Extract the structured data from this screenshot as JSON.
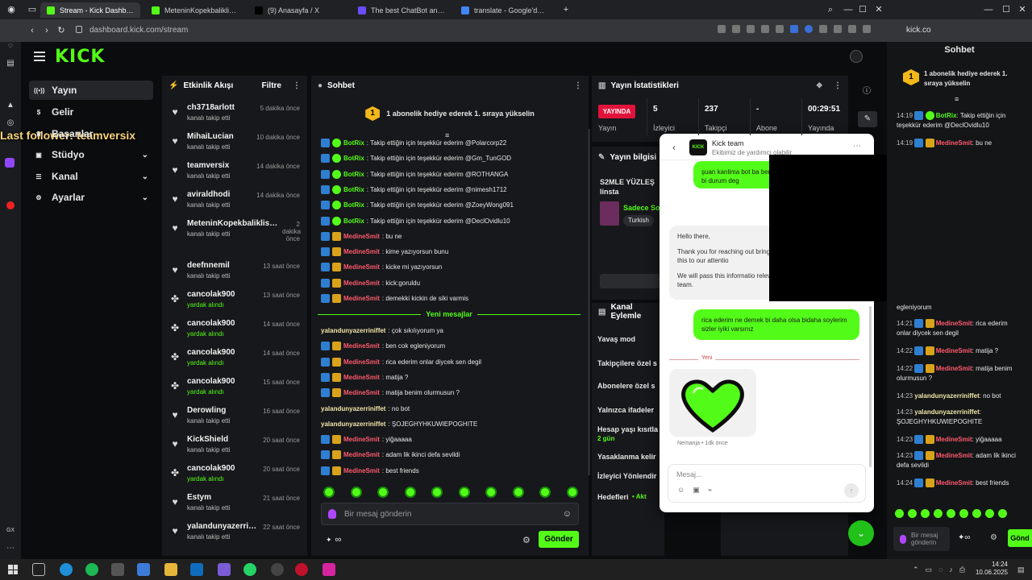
{
  "browser": {
    "tabs": [
      {
        "title": "Stream - Kick Dashboard",
        "color": "#53fc18",
        "active": true
      },
      {
        "title": "MeteninKopekbaliklisort3",
        "color": "#53fc18",
        "active": false
      },
      {
        "title": "(9) Anasayfa / X",
        "color": "#000000",
        "active": false
      },
      {
        "title": "The best ChatBot and Wi",
        "color": "#6b4cff",
        "active": false
      },
      {
        "title": "translate - Google'da Ara",
        "color": "#4285f4",
        "active": false
      }
    ],
    "url": "dashboard.kick.com/stream",
    "right_url": "kick.co"
  },
  "sidebar": {
    "logo": "KICK",
    "items": [
      {
        "label": "Yayın",
        "icon": "broadcast-icon",
        "active": true
      },
      {
        "label": "Gelir",
        "icon": "money-icon",
        "active": false
      },
      {
        "label": "Başarılar",
        "icon": "trophy-icon",
        "active": false
      },
      {
        "label": "Stüdyo",
        "icon": "studio-icon",
        "active": false
      },
      {
        "label": "Kanal",
        "icon": "channel-icon",
        "active": false
      },
      {
        "label": "Ayarlar",
        "icon": "gear-icon",
        "active": false
      }
    ],
    "overlay_text": "Last follower: teamversix"
  },
  "activity": {
    "title": "Etkinlik Akışı",
    "filter_label": "Filtre",
    "items": [
      {
        "name": "ch3718arlott",
        "sub": "kanalı takip etti",
        "time": "5 dakika önce",
        "type": "follow"
      },
      {
        "name": "MihaiLucian",
        "sub": "kanalı takip etti",
        "time": "10 dakika önce",
        "type": "follow"
      },
      {
        "name": "teamversix",
        "sub": "kanalı takip etti",
        "time": "14 dakika önce",
        "type": "follow"
      },
      {
        "name": "aviraldhodi",
        "sub": "kanalı takip etti",
        "time": "14 dakika önce",
        "type": "follow"
      },
      {
        "name": "MeteninKopekbaliklisort31",
        "sub": "kanalı takip etti",
        "time": "2 dakika önce",
        "type": "follow"
      },
      {
        "name": "deefnnemil",
        "sub": "kanalı takip etti",
        "time": "13 saat önce",
        "type": "follow"
      },
      {
        "name": "cancolak900",
        "sub": "yardak alındı",
        "time": "13 saat önce",
        "type": "sub"
      },
      {
        "name": "cancolak900",
        "sub": "yardak alındı",
        "time": "14 saat önce",
        "type": "sub"
      },
      {
        "name": "cancolak900",
        "sub": "yardak alındı",
        "time": "14 saat önce",
        "type": "sub"
      },
      {
        "name": "cancolak900",
        "sub": "yardak alındı",
        "time": "15 saat önce",
        "type": "sub"
      },
      {
        "name": "Derowling",
        "sub": "kanalı takip etti",
        "time": "16 saat önce",
        "type": "follow"
      },
      {
        "name": "KickShield",
        "sub": "kanalı takip etti",
        "time": "20 saat önce",
        "type": "follow"
      },
      {
        "name": "cancolak900",
        "sub": "yardak alındı",
        "time": "20 saat önce",
        "type": "sub"
      },
      {
        "name": "Estym",
        "sub": "kanalı takip etti",
        "time": "21 saat önce",
        "type": "follow"
      },
      {
        "name": "yalandunyazerriniffet",
        "sub": "kanalı takip etti",
        "time": "22 saat önce",
        "type": "follow"
      }
    ]
  },
  "chat": {
    "title": "Sohbet",
    "pinned": "1 abonelik hediye ederek 1. sıraya yükselin",
    "pinned_rank": "1",
    "messages": [
      {
        "user": "BotRix",
        "kind": "bot",
        "text": ": Takip ettiğin için teşekkür ederim @Polarcorp22"
      },
      {
        "user": "BotRix",
        "kind": "bot",
        "text": ": Takip ettiğin için teşekkür ederim @Gm_TunGOD"
      },
      {
        "user": "BotRix",
        "kind": "bot",
        "text": ": Takip ettiğin için teşekkür ederim @ROTHANGA"
      },
      {
        "user": "BotRix",
        "kind": "bot",
        "text": ": Takip ettiğin için teşekkür ederim @nimesh1712"
      },
      {
        "user": "BotRix",
        "kind": "bot",
        "text": ": Takip ettiğin için teşekkür ederim @ZoeyWong091"
      },
      {
        "user": "BotRix",
        "kind": "bot",
        "text": ": Takip ettiğin için teşekkür ederim @DeclOvidlu10"
      },
      {
        "user": "MedineSmit",
        "kind": "med",
        "text": ": bu ne"
      },
      {
        "user": "MedineSmit",
        "kind": "med",
        "text": ": kime yazıyorsun bunu"
      },
      {
        "user": "MedineSmit",
        "kind": "med",
        "text": ": kicke mi yazıyorsun"
      },
      {
        "user": "MedineSmit",
        "kind": "med",
        "text": ": kick:goruldu"
      },
      {
        "user": "MedineSmit",
        "kind": "med",
        "text": ": demekki kickin de siki varmis"
      }
    ],
    "divider": "Yeni mesajlar",
    "new_messages": [
      {
        "user": "yalandunyazerriniffet",
        "kind": "yal",
        "text": ": çok sıkılıyorum ya"
      },
      {
        "user": "MedineSmit",
        "kind": "med",
        "text": ": ben cok egleniyorum"
      },
      {
        "user": "MedineSmit",
        "kind": "med",
        "text": ": rica ederim onlar diycek sen degil"
      },
      {
        "user": "MedineSmit",
        "kind": "med",
        "text": ": matija ?"
      },
      {
        "user": "MedineSmit",
        "kind": "med",
        "text": ": matija benim olurmusun ?"
      },
      {
        "user": "yalandunyazerriniffet",
        "kind": "yal",
        "text": ": no bot"
      },
      {
        "user": "yalandunyazerriniffet",
        "kind": "yal",
        "text": ": ŞOJEGHYHKUWIEPOGHITE"
      },
      {
        "user": "MedineSmit",
        "kind": "med",
        "text": ": yiğaaaaa"
      },
      {
        "user": "MedineSmit",
        "kind": "med",
        "text": ": adam lik ikinci defa sevildi"
      },
      {
        "user": "MedineSmit",
        "kind": "med",
        "text": ": best friends"
      }
    ],
    "input_placeholder": "Bir mesaj gönderin",
    "send_label": "Gönder",
    "points": "∞"
  },
  "stats": {
    "title": "Yayın İstatistikleri",
    "live_badge": "YAYINDA",
    "live_label": "Yayın",
    "items": [
      {
        "value": "5",
        "label": "İzleyici"
      },
      {
        "value": "237",
        "label": "Takipçi"
      },
      {
        "value": "-",
        "label": "Abone"
      },
      {
        "value": "00:29:51",
        "label": "Yayında"
      }
    ]
  },
  "stream_info": {
    "title": "Yayın bilgisi",
    "stream_title": "S2MLE YÜZLEŞ Iinsta",
    "category": "Sadece So",
    "language": "Turkish"
  },
  "channel_actions": {
    "title": "Kanal Eylemle",
    "items": [
      {
        "label": "Yavaş mod",
        "sub": ""
      },
      {
        "label": "Takipçilere özel s",
        "sub": ""
      },
      {
        "label": "Abonelere özel s",
        "sub": ""
      },
      {
        "label": "Yalnızca ifadeler",
        "sub": ""
      },
      {
        "label": "Hesap yaşı kısıtla",
        "sub": "2 gün"
      },
      {
        "label": "Yasaklanma kelir",
        "sub": ""
      },
      {
        "label": "İzleyici Yönlendir",
        "sub": ""
      },
      {
        "label": "Hedefleri",
        "sub": "• Akt"
      }
    ]
  },
  "support": {
    "team_name": "Kick team",
    "team_sub": "Ekibimiz de yardımcı olabilir",
    "logo": "KICK",
    "msg_out_1": "şuan kanlima bot ba benlik bi durum deg",
    "msg_in": [
      "Hello there,",
      "Thank you for reaching out bringing this to our attentio",
      "We will pass this informatio relevant team."
    ],
    "msg_out_2": "rica ederim ne demek bi daha olsa bidaha soylerim sizler iyiki varsınız",
    "new_label": "Yeni",
    "signature": "Nemanja • 1dk önce",
    "input_placeholder": "Mesaj..."
  },
  "right_chat": {
    "title": "Sohbet",
    "pinned": "1 abonelik hediye ederek 1. sıraya yükselin",
    "lines": [
      {
        "time": "14:19",
        "user": "BotRix",
        "kind": "bot",
        "text": ": Takip ettiğin için teşekkür ederim @DeclOvidlu10"
      },
      {
        "time": "14:19",
        "user": "MedineSmit",
        "kind": "med",
        "text": ": bu ne"
      },
      {
        "time": "",
        "user": "",
        "kind": "plain",
        "text": "egleniyorum"
      },
      {
        "time": "14:21",
        "user": "MedineSmit",
        "kind": "med",
        "text": ": rica ederim onlar diycek sen degil"
      },
      {
        "time": "14:22",
        "user": "MedineSmit",
        "kind": "med",
        "text": ": matija ?"
      },
      {
        "time": "14:22",
        "user": "MedineSmit",
        "kind": "med",
        "text": ": matija benim olurmusun ?"
      },
      {
        "time": "14:23",
        "user": "yalandunyazerriniffet",
        "kind": "yal",
        "text": ": no bot"
      },
      {
        "time": "14:23",
        "user": "yalandunyazerriniffet",
        "kind": "yal",
        "text": ": ŞOJEGHYHKUWIEPOGHITE"
      },
      {
        "time": "14:23",
        "user": "MedineSmit",
        "kind": "med",
        "text": ": yiğaaaaa"
      },
      {
        "time": "14:23",
        "user": "MedineSmit",
        "kind": "med",
        "text": ": adam lik ikinci defa sevildi"
      },
      {
        "time": "14:24",
        "user": "MedineSmit",
        "kind": "med",
        "text": ": best friends"
      }
    ],
    "input_placeholder": "Bir mesaj gönderin",
    "send_label": "Gönd"
  },
  "taskbar": {
    "time": "14:24",
    "date": "10.06.2025"
  }
}
